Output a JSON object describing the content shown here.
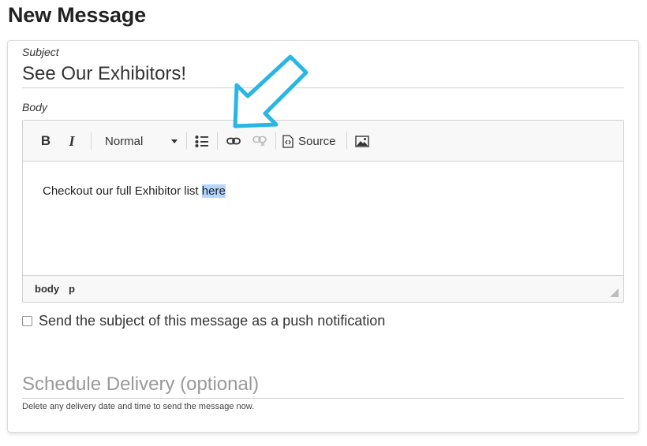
{
  "page": {
    "title": "New Message"
  },
  "subject": {
    "label": "Subject",
    "value": "See Our Exhibitors!"
  },
  "body": {
    "label": "Body",
    "toolbar": {
      "bold": "B",
      "italic": "I",
      "format_value": "Normal",
      "source_label": "Source",
      "icons": [
        "bold-icon",
        "italic-icon",
        "chevron-down-icon",
        "bulleted-list-icon",
        "link-icon",
        "unlink-icon",
        "source-icon",
        "image-icon"
      ]
    },
    "content": {
      "text": "Checkout our full Exhibitor list ",
      "selected_text": "here"
    },
    "path": [
      "body",
      "p"
    ]
  },
  "push": {
    "checked": false,
    "label": "Send the subject of this message as a push notification"
  },
  "schedule": {
    "placeholder": "Schedule Delivery (optional)",
    "help": "Delete any delivery date and time to send the message now."
  },
  "colors": {
    "arrow": "#29b6e3",
    "selection": "#b4d5fe",
    "toolbar_bg": "#f8f8f8"
  }
}
